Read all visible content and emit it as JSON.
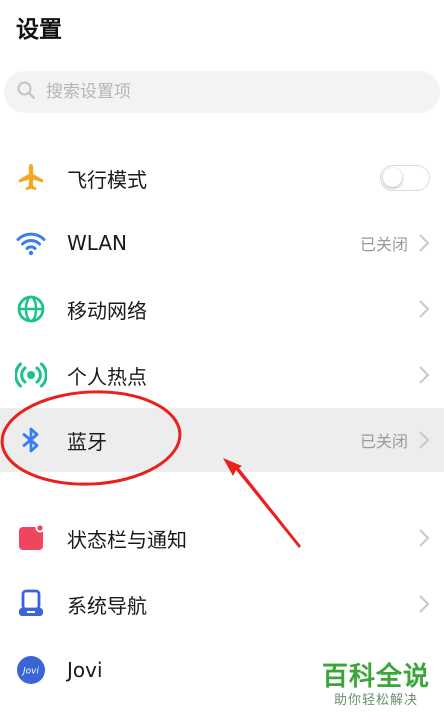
{
  "header": {
    "title": "设置"
  },
  "search": {
    "placeholder": "搜索设置项"
  },
  "settings": [
    {
      "label": "飞行模式",
      "icon": "airplane-icon",
      "color": "#f5a623",
      "control": "toggle",
      "toggle_on": false
    },
    {
      "label": "WLAN",
      "icon": "wifi-icon",
      "color": "#3b7cf4",
      "status": "已关闭"
    },
    {
      "label": "移动网络",
      "icon": "globe-icon",
      "color": "#1bc38b"
    },
    {
      "label": "个人热点",
      "icon": "hotspot-icon",
      "color": "#1bc38b"
    },
    {
      "label": "蓝牙",
      "icon": "bluetooth-icon",
      "color": "#3b7cf4",
      "status": "已关闭"
    },
    {
      "label": "状态栏与通知",
      "icon": "notification-icon",
      "color": "#f0455f"
    },
    {
      "label": "系统导航",
      "icon": "navigation-icon",
      "color": "#3b64d8"
    },
    {
      "label": "Jovi",
      "icon": "jovi-icon",
      "color": "#3b64d8",
      "icon_text": "Jovi"
    }
  ],
  "watermark": {
    "main": "百科全说",
    "sub": "助你轻松解决"
  },
  "annotation": {
    "color": "#e8211d"
  }
}
